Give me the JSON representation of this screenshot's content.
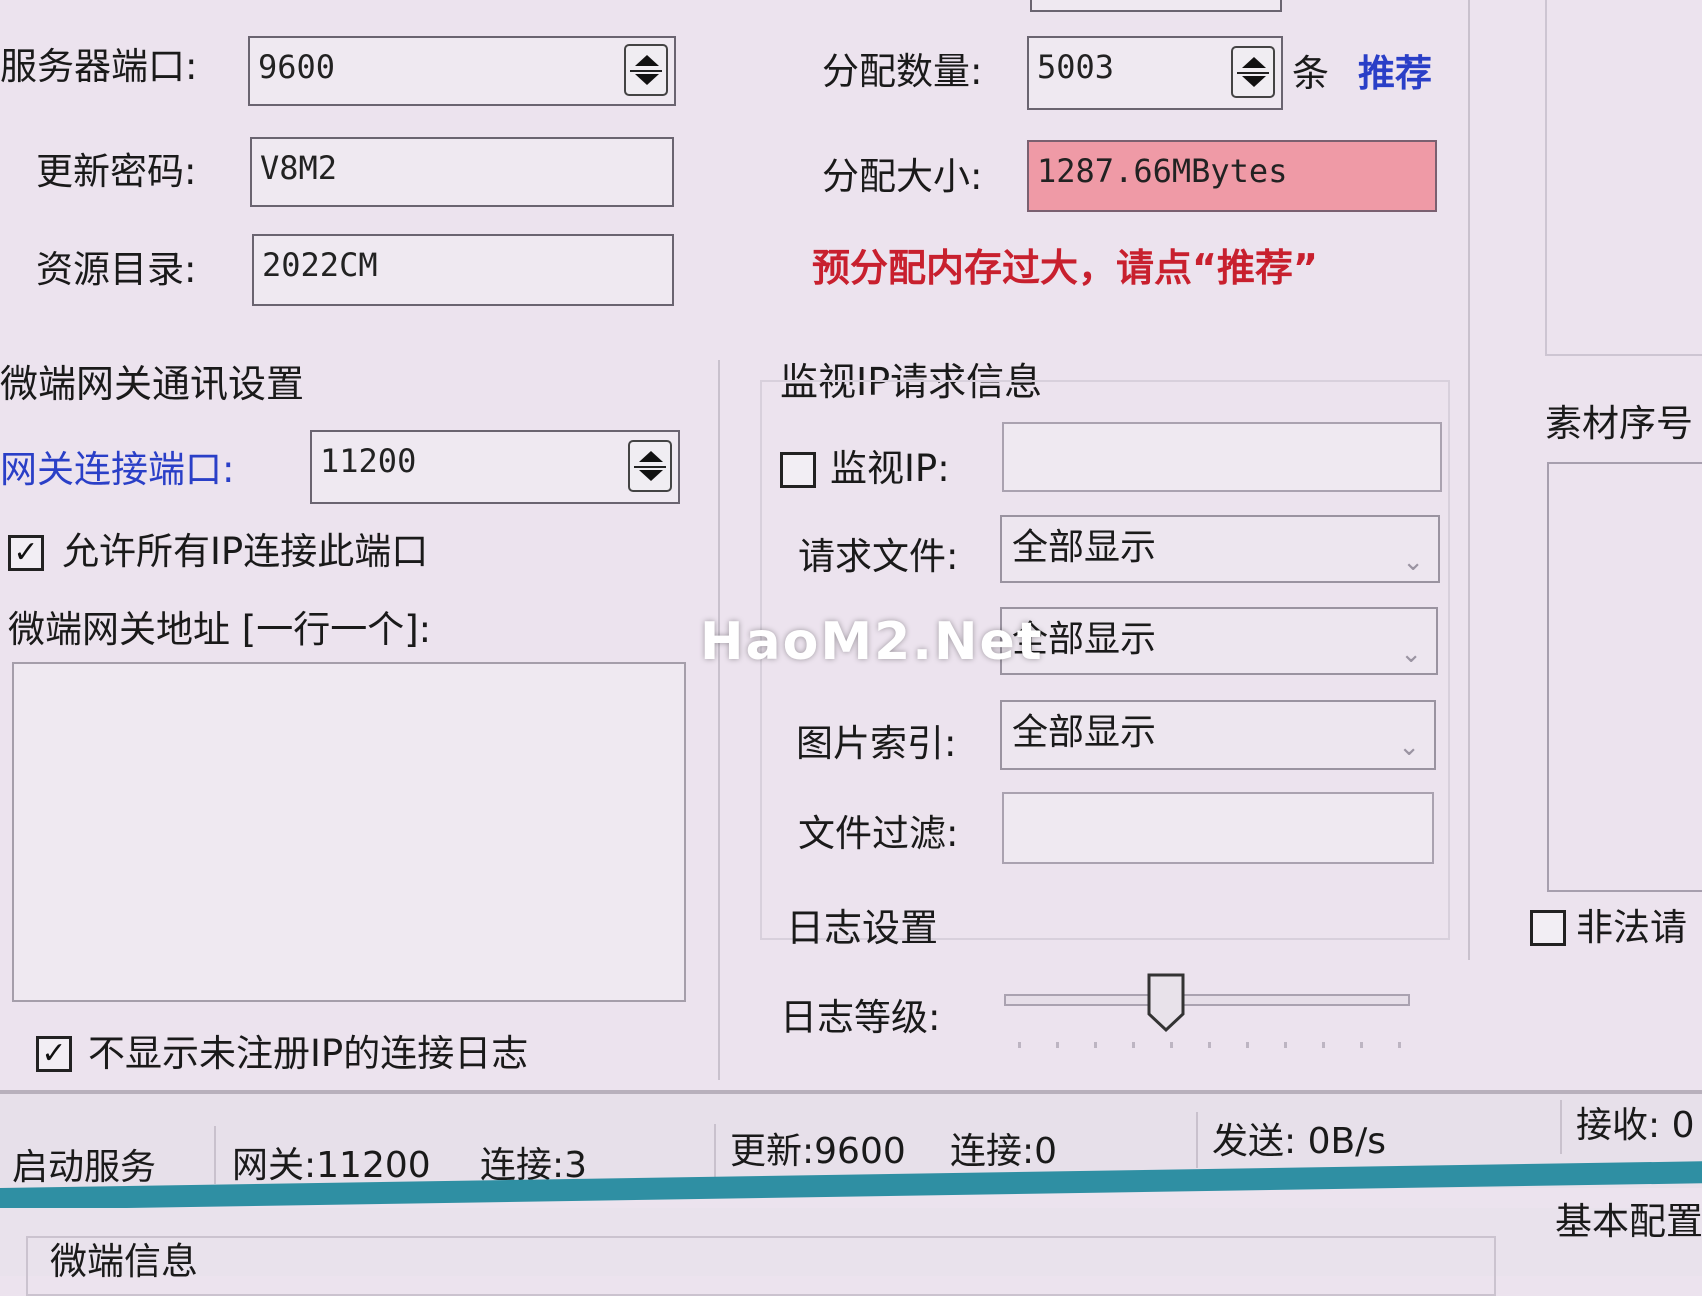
{
  "server": {
    "port_label": "服务器端口:",
    "port_value": "9600",
    "password_label": "更新密码:",
    "password_value": "V8M2",
    "resource_label": "资源目录:",
    "resource_value": "2022CM"
  },
  "alloc": {
    "count_label": "分配数量:",
    "count_value": "5003",
    "count_unit": "条",
    "recommend_link": "推荐",
    "size_label": "分配大小:",
    "size_value": "1287.66MBytes",
    "warning": "预分配内存过大，请点“推荐”"
  },
  "gateway": {
    "section_title": "微端网关通讯设置",
    "port_label": "网关连接端口:",
    "port_value": "11200",
    "allow_all_label": "允许所有IP连接此端口",
    "allow_all_checked": true,
    "address_label": "微端网关地址 [一行一个]:",
    "address_value": "",
    "hide_unregistered_label": "不显示未注册IP的连接日志",
    "hide_unregistered_checked": true
  },
  "monitor": {
    "section_title": "监视IP请求信息",
    "monitor_ip_label": "监视IP:",
    "monitor_ip_checked": false,
    "monitor_ip_value": "",
    "request_file_label": "请求文件:",
    "request_file_value": "全部显示",
    "second_combo_value": "全部显示",
    "image_index_label": "图片索引:",
    "image_index_value": "全部显示",
    "file_filter_label": "文件过滤:",
    "file_filter_value": ""
  },
  "log": {
    "section_title": "日志设置",
    "level_label": "日志等级:",
    "level_fraction": 0.4
  },
  "right": {
    "material_label": "素材序号",
    "illegal_label": "非法请",
    "illegal_checked": false,
    "basic_config_tab": "基本配置"
  },
  "status_bar": {
    "start_service": "启动服务",
    "gateway": "网关:11200",
    "gateway_conn": "连接:3",
    "update": "更新:9600",
    "update_conn": "连接:0",
    "send": "发送: 0B/s",
    "receive": "接收: 0"
  },
  "bottom": {
    "micro_info": "微端信息"
  },
  "watermark": "HaoM2.Net",
  "colors": {
    "link_blue": "#2a3fc7",
    "warning_red": "#c8202e",
    "pink_field": "#ef9aa6",
    "taskbar_teal": "#2f8fa3"
  }
}
